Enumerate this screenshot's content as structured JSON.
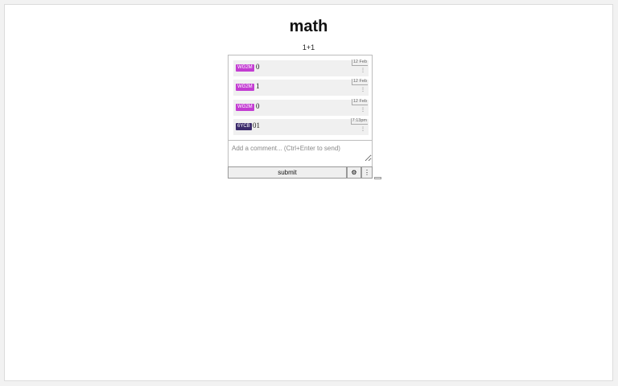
{
  "page": {
    "title": "math",
    "subtitle": "1+1"
  },
  "comments": [
    {
      "user": "WG2M",
      "text": "0",
      "time": "12 Feb",
      "menu": "⋮",
      "color": "#c33dd2"
    },
    {
      "user": "WG2M",
      "text": "1",
      "time": "12 Feb",
      "menu": "⋮",
      "color": "#c33dd2"
    },
    {
      "user": "WG2M",
      "text": "0",
      "time": "12 Feb",
      "menu": "⋮",
      "color": "#c33dd2"
    },
    {
      "user": "6YCB",
      "text": "01",
      "time": "7:13pm",
      "menu": "⋮",
      "color": "#3b2a6b"
    }
  ],
  "composer": {
    "placeholder": "Add a comment... (Ctrl+Enter to send)",
    "submit_label": "submit",
    "settings_icon": "⚙",
    "more_icon": "⋮"
  }
}
